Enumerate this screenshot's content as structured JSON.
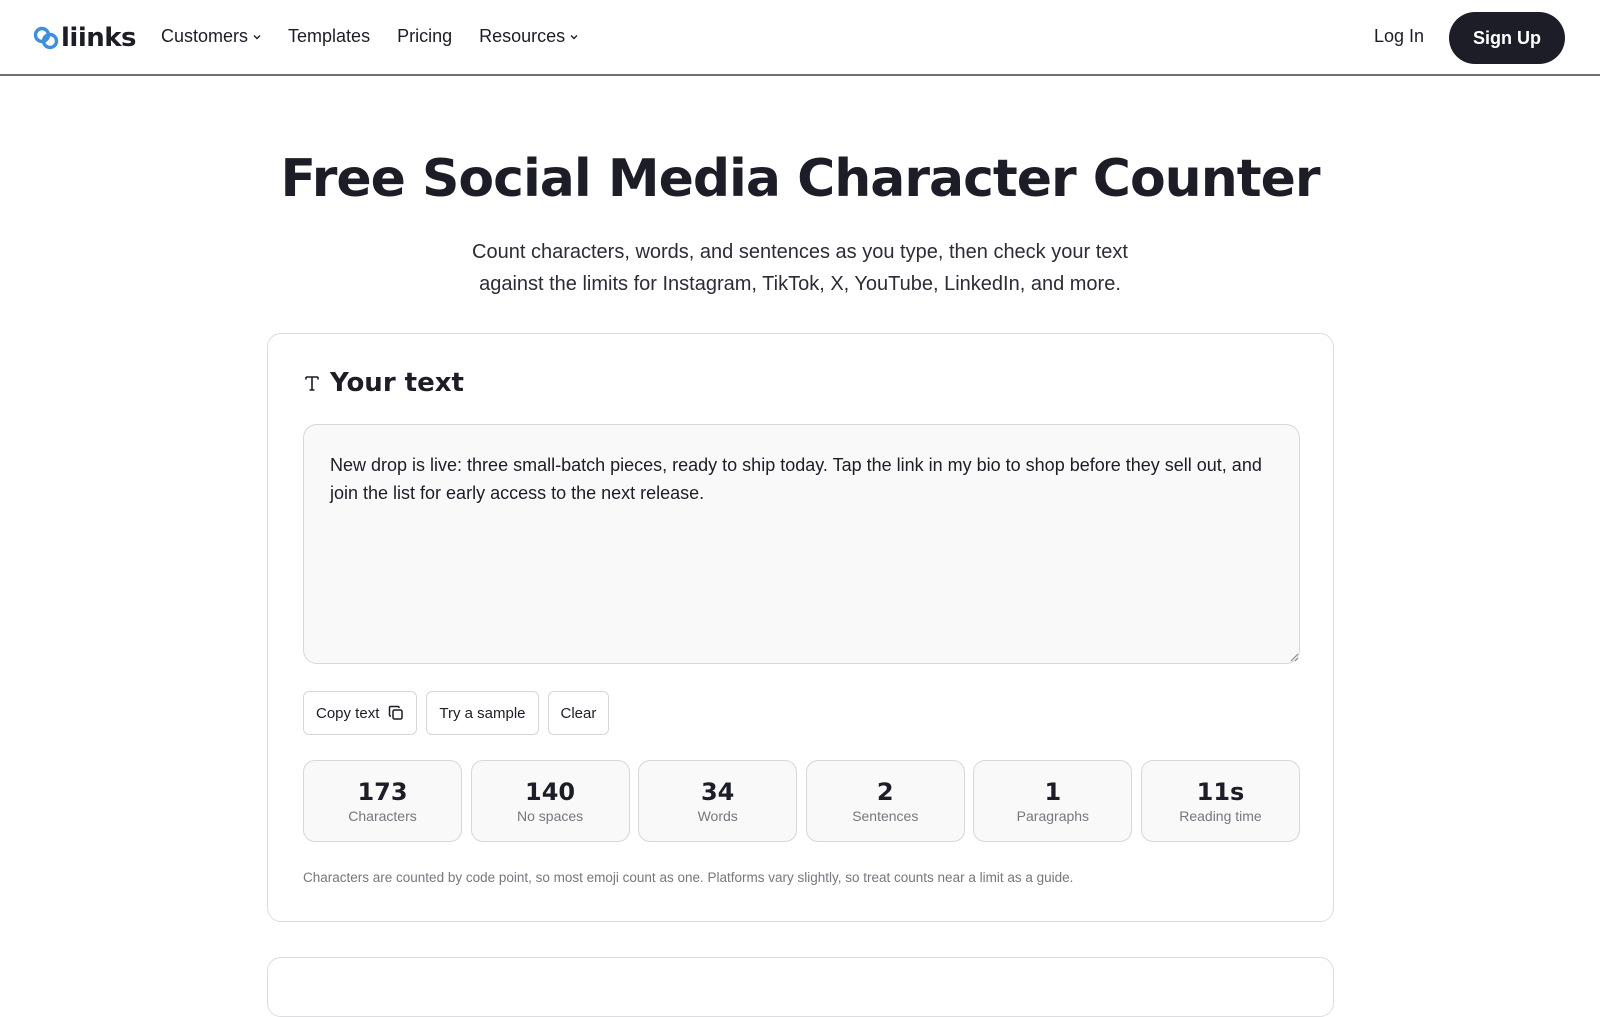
{
  "nav": {
    "logo_text": "liinks",
    "links": [
      {
        "label": "Customers",
        "dropdown": true
      },
      {
        "label": "Templates",
        "dropdown": false
      },
      {
        "label": "Pricing",
        "dropdown": false
      },
      {
        "label": "Resources",
        "dropdown": true
      }
    ],
    "login_label": "Log In",
    "signup_label": "Sign Up"
  },
  "hero": {
    "title_plain": "Free Social Media ",
    "title_highlight": "Character Counter",
    "subtitle_line1": "Count characters, words, and sentences as you type, then check your text",
    "subtitle_line2": "against the limits for Instagram, TikTok, X, YouTube, LinkedIn, and more."
  },
  "editor": {
    "heading": "Your text",
    "text": "New drop is live: three small-batch pieces, ready to ship today. Tap the link in my bio to shop before they sell out, and join the list for early access to the next release.",
    "buttons": {
      "copy": "Copy text",
      "sample": "Try a sample",
      "clear": "Clear"
    },
    "stats": [
      {
        "value": "173",
        "label": "Characters"
      },
      {
        "value": "140",
        "label": "No spaces"
      },
      {
        "value": "34",
        "label": "Words"
      },
      {
        "value": "2",
        "label": "Sentences"
      },
      {
        "value": "1",
        "label": "Paragraphs"
      },
      {
        "value": "11s",
        "label": "Reading time"
      }
    ],
    "note": "Characters are counted by code point, so most emoji count as one. Platforms vary slightly, so treat counts near a limit as a guide."
  },
  "colors": {
    "accent_blue": "#3d8fe0",
    "highlight": "#9ad1f5",
    "dark": "#1c1d26",
    "muted": "#76777f"
  }
}
